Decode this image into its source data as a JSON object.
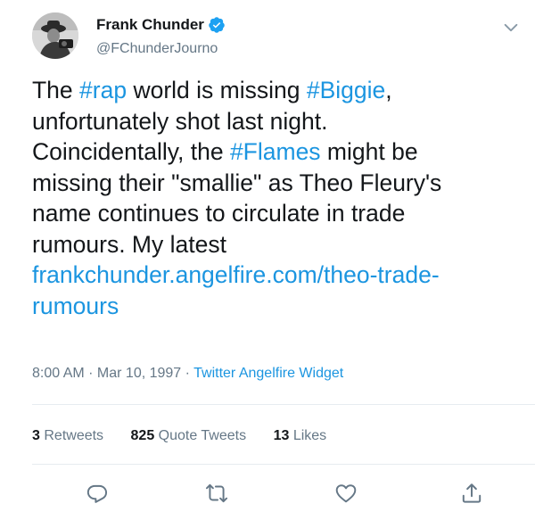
{
  "author": {
    "display_name": "Frank Chunder",
    "handle": "@FChunderJourno",
    "verified": true
  },
  "tweet": {
    "lines": [
      [
        {
          "t": "The "
        },
        {
          "t": "#rap",
          "link": true
        },
        {
          "t": " world is missing "
        },
        {
          "t": "#Biggie",
          "link": true
        },
        {
          "t": ","
        }
      ],
      [
        {
          "t": "unfortunately shot last night."
        }
      ],
      [
        {
          "t": "Coincidentally, the "
        },
        {
          "t": "#Flames",
          "link": true
        },
        {
          "t": " might be"
        }
      ],
      [
        {
          "t": "missing their \"smallie\" as Theo Fleury's"
        }
      ],
      [
        {
          "t": "name continues to circulate in trade"
        }
      ],
      [
        {
          "t": "rumours. My latest"
        }
      ],
      [
        {
          "t": "frankchunder.angelfire.com/theo-trade-",
          "link": true
        }
      ],
      [
        {
          "t": "rumours",
          "link": true
        }
      ]
    ]
  },
  "meta": {
    "time": "8:00 AM",
    "sep1": " · ",
    "date": "Mar 10, 1997",
    "sep2": " · ",
    "source": "Twitter Angelfire Widget"
  },
  "stats": {
    "retweets_count": "3",
    "retweets_label": "Retweets",
    "quotes_count": "825",
    "quotes_label": "Quote Tweets",
    "likes_count": "13",
    "likes_label": "Likes"
  },
  "colors": {
    "link": "#1b95e0",
    "muted": "#657786",
    "text": "#14171a",
    "divider": "#e6ecf0"
  },
  "icons": {
    "verified": "verified-badge-icon",
    "menu": "chevron-down-icon",
    "reply": "reply-icon",
    "retweet": "retweet-icon",
    "like": "heart-icon",
    "share": "share-icon"
  }
}
